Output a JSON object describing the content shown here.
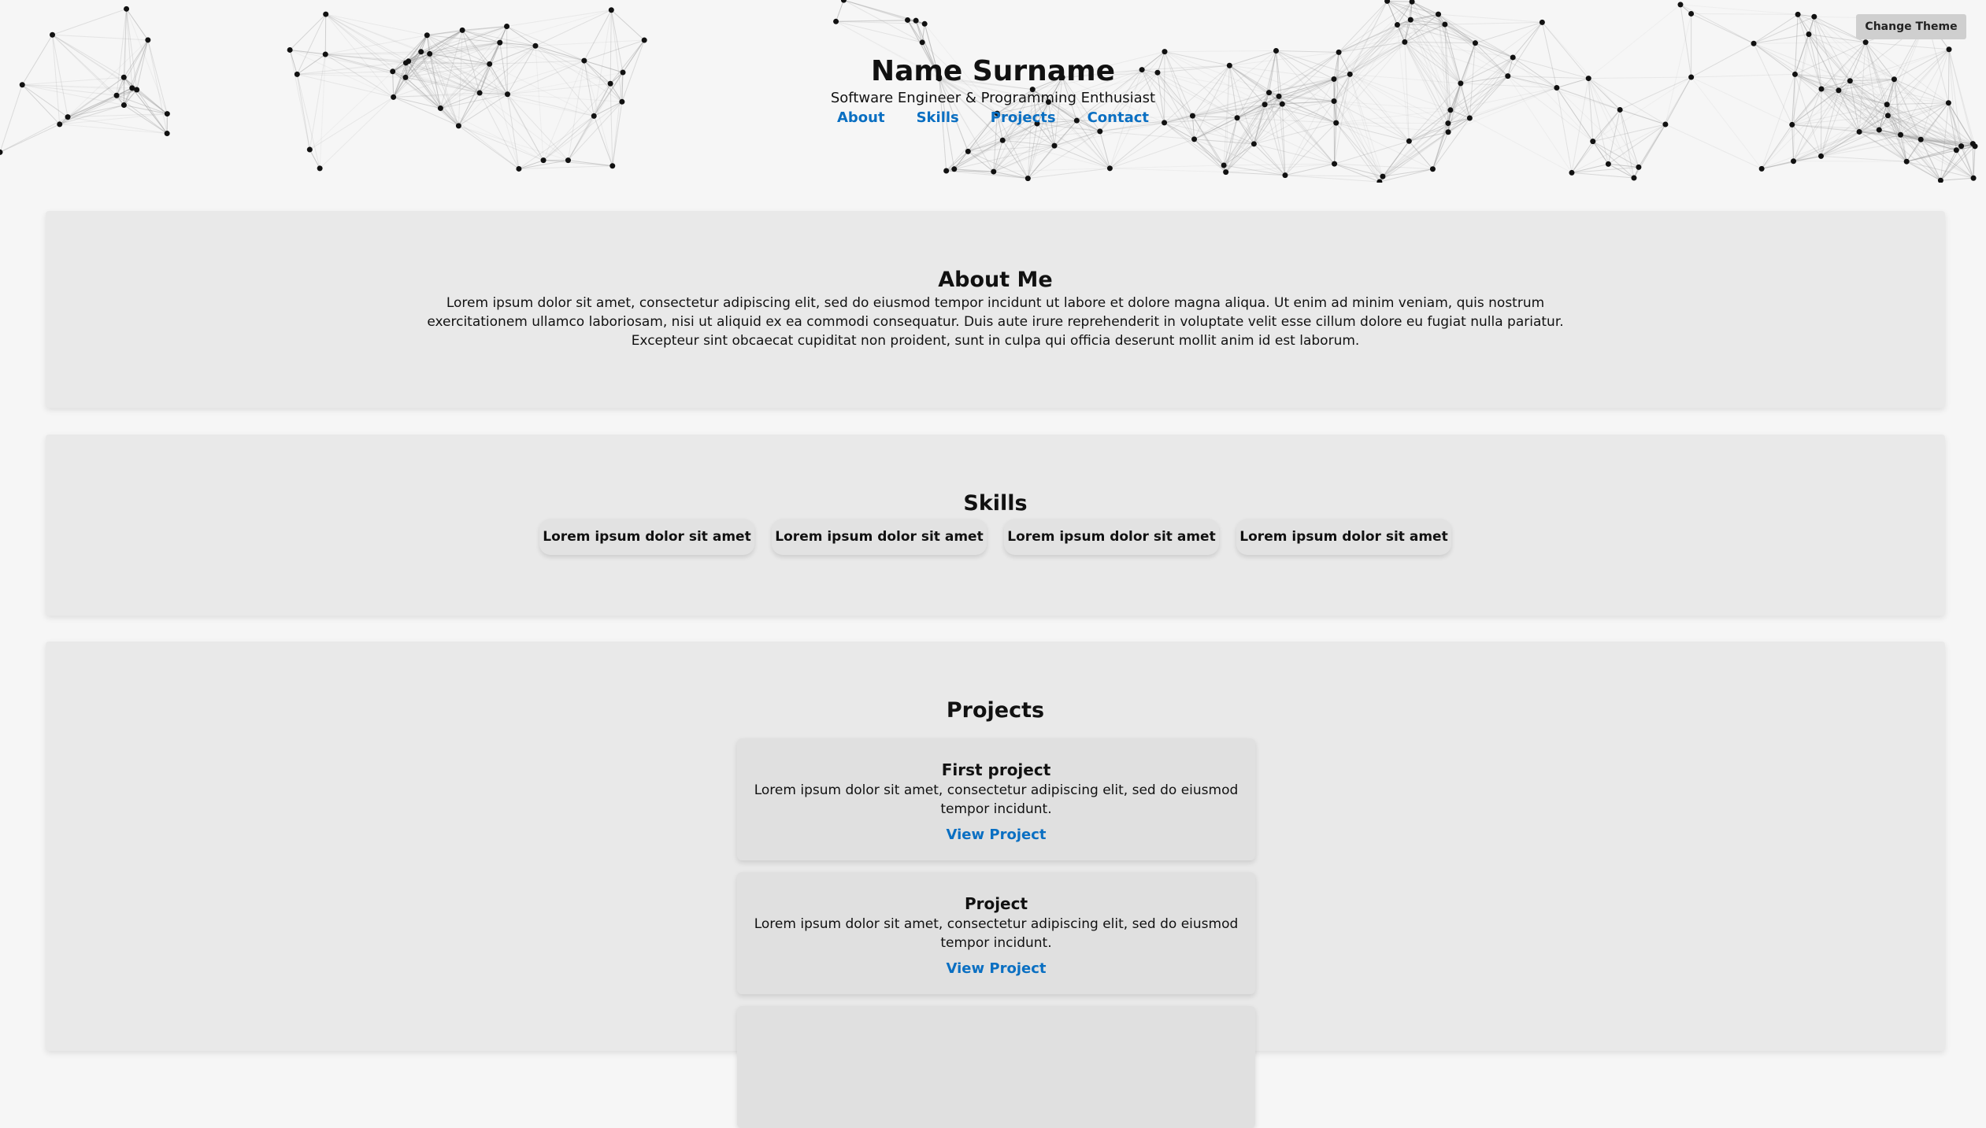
{
  "header": {
    "title": "Name Surname",
    "subtitle": "Software Engineer & Programming Enthusiast",
    "nav": [
      {
        "label": "About"
      },
      {
        "label": "Skills"
      },
      {
        "label": "Projects"
      },
      {
        "label": "Contact"
      }
    ],
    "theme_button": "Change Theme"
  },
  "about": {
    "heading": "About Me",
    "text": "Lorem ipsum dolor sit amet, consectetur adipiscing elit, sed do eiusmod tempor incidunt ut labore et dolore magna aliqua. Ut enim ad minim veniam, quis nostrum exercitationem ullamco laboriosam, nisi ut aliquid ex ea commodi consequatur. Duis aute irure reprehenderit in voluptate velit esse cillum dolore eu fugiat nulla pariatur. Excepteur sint obcaecat cupiditat non proident, sunt in culpa qui officia deserunt mollit anim id est laborum."
  },
  "skills": {
    "heading": "Skills",
    "items": [
      "Lorem ipsum dolor sit amet",
      "Lorem ipsum dolor sit amet",
      "Lorem ipsum dolor sit amet",
      "Lorem ipsum dolor sit amet"
    ]
  },
  "projects": {
    "heading": "Projects",
    "items": [
      {
        "title": "First project",
        "description": "Lorem ipsum dolor sit amet, consectetur adipiscing elit, sed do eiusmod tempor incidunt.",
        "link": "View Project"
      },
      {
        "title": "Project",
        "description": "Lorem ipsum dolor sit amet, consectetur adipiscing elit, sed do eiusmod tempor incidunt.",
        "link": "View Project"
      }
    ]
  },
  "colors": {
    "background": "#f6f6f6",
    "panel": "#e9e9e9",
    "card": "#e0e0e0",
    "link": "#0a6fc2",
    "button": "#cfcfcf",
    "network_node": "#111111",
    "network_line": "#9a9a9a"
  }
}
